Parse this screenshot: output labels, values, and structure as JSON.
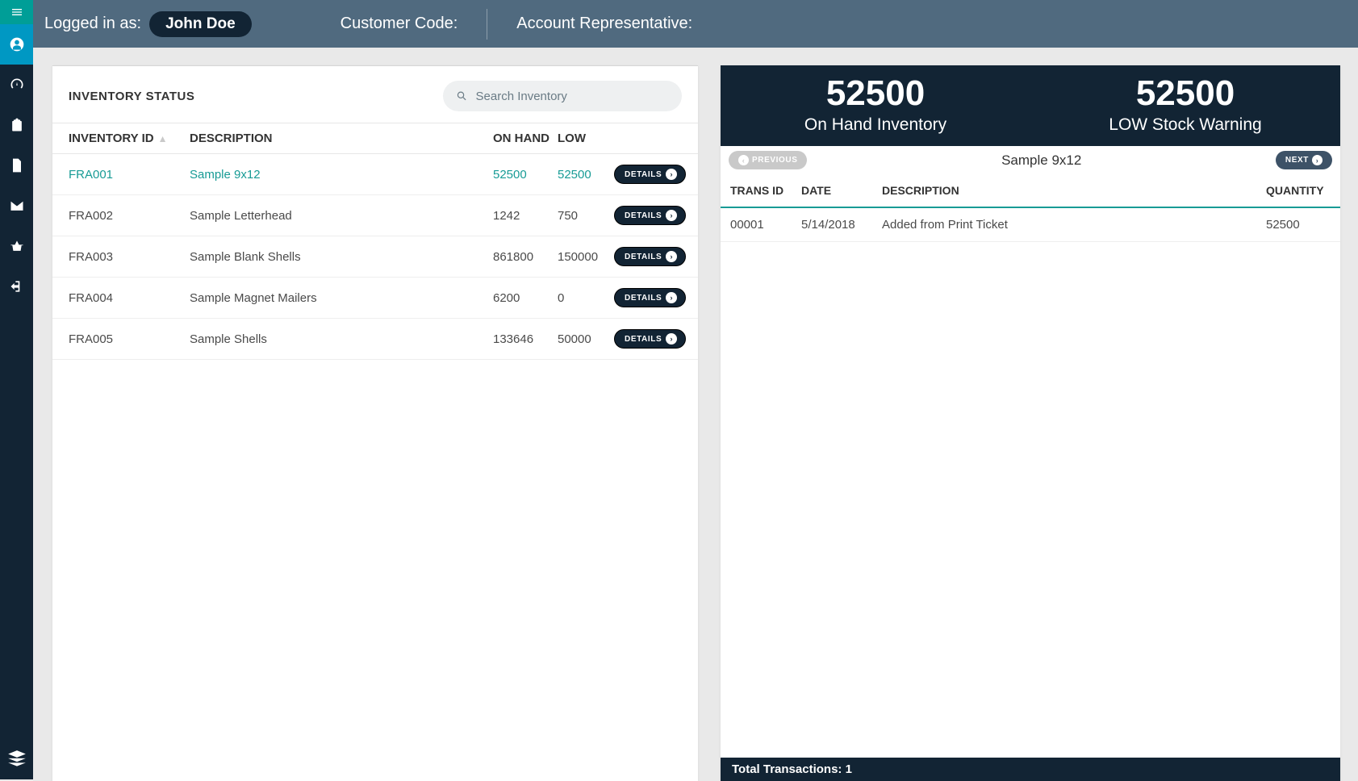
{
  "topbar": {
    "logged_in_label": "Logged in as:",
    "user_name": "John Doe",
    "customer_code_label": "Customer Code:",
    "account_rep_label": "Account Representative:"
  },
  "left_panel": {
    "title": "INVENTORY STATUS",
    "search_placeholder": "Search Inventory",
    "columns": {
      "id": "INVENTORY ID",
      "desc": "DESCRIPTION",
      "onhand": "ON HAND",
      "low": "LOW"
    },
    "details_label": "DETAILS",
    "rows": [
      {
        "id": "FRA001",
        "desc": "Sample 9x12",
        "onhand": "52500",
        "low": "52500",
        "selected": true
      },
      {
        "id": "FRA002",
        "desc": "Sample Letterhead",
        "onhand": "1242",
        "low": "750",
        "selected": false
      },
      {
        "id": "FRA003",
        "desc": "Sample Blank Shells",
        "onhand": "861800",
        "low": "150000",
        "selected": false
      },
      {
        "id": "FRA004",
        "desc": "Sample Magnet Mailers",
        "onhand": "6200",
        "low": "0",
        "selected": false
      },
      {
        "id": "FRA005",
        "desc": "Sample Shells",
        "onhand": "133646",
        "low": "50000",
        "selected": false
      }
    ]
  },
  "right_panel": {
    "summary": {
      "onhand_value": "52500",
      "onhand_label": "On Hand Inventory",
      "low_value": "52500",
      "low_label": "LOW Stock Warning"
    },
    "prev_label": "PREVIOUS",
    "next_label": "NEXT",
    "item_name": "Sample 9x12",
    "columns": {
      "tid": "TRANS ID",
      "date": "DATE",
      "desc": "DESCRIPTION",
      "qty": "QUANTITY"
    },
    "rows": [
      {
        "tid": "00001",
        "date": "5/14/2018",
        "desc": "Added from Print Ticket",
        "qty": "52500"
      }
    ],
    "footer_label": "Total Transactions:",
    "footer_count": "1"
  }
}
